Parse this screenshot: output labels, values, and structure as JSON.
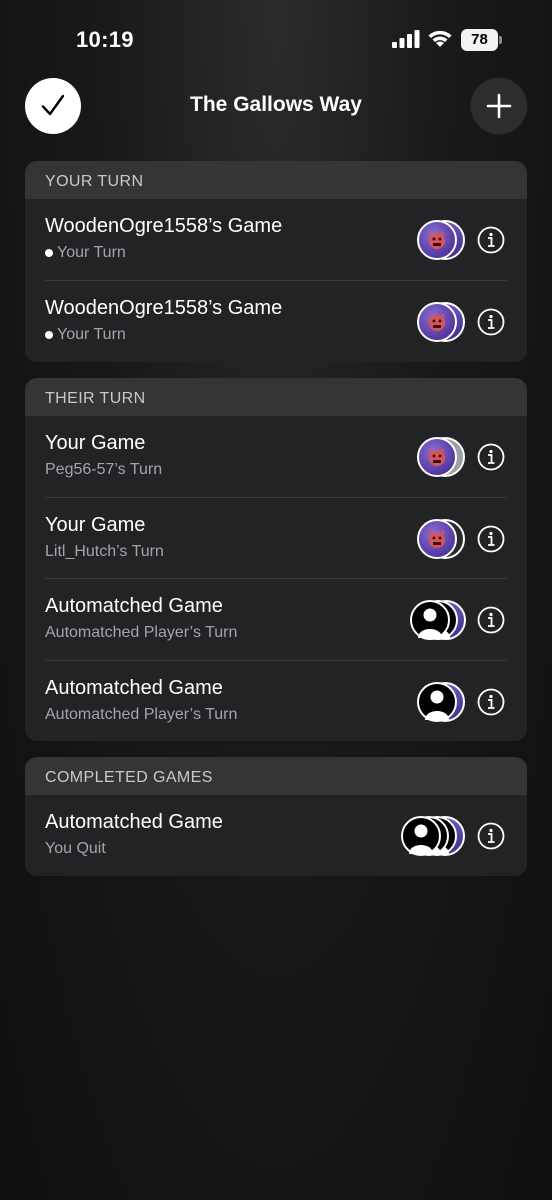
{
  "status_bar": {
    "time": "10:19",
    "battery": "78"
  },
  "nav": {
    "title": "The Gallows Way",
    "done_icon": "checkmark-icon",
    "add_icon": "plus-icon"
  },
  "sections": {
    "your_turn": {
      "header": "YOUR TURN",
      "rows": [
        {
          "title": "WoodenOgre1558’s Game",
          "subtitle": "Your Turn"
        },
        {
          "title": "WoodenOgre1558’s Game",
          "subtitle": "Your Turn"
        }
      ]
    },
    "their_turn": {
      "header": "THEIR TURN",
      "rows": [
        {
          "title": "Your Game",
          "subtitle": "Peg56-57’s Turn"
        },
        {
          "title": "Your Game",
          "subtitle": "Litl_Hutch’s Turn"
        },
        {
          "title": "Automatched Game",
          "subtitle": "Automatched Player’s Turn"
        },
        {
          "title": "Automatched Game",
          "subtitle": "Automatched Player’s Turn"
        }
      ]
    },
    "completed": {
      "header": "COMPLETED GAMES",
      "rows": [
        {
          "title": "Automatched Game",
          "subtitle": "You Quit"
        }
      ]
    }
  },
  "colors": {
    "background": "#121314",
    "section_bg": "#222325",
    "section_header_bg": "#343537",
    "avatar_purple": "#6a4fb8"
  }
}
